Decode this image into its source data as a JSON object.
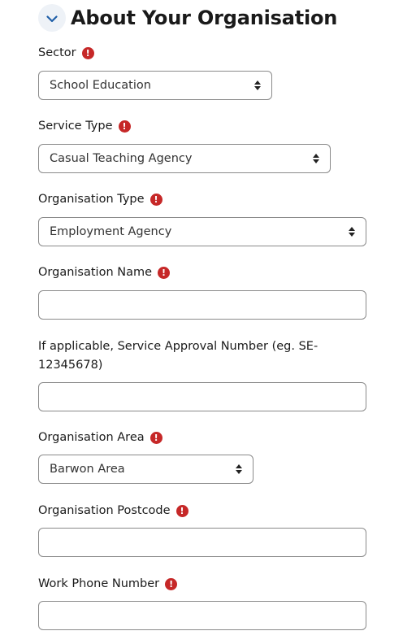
{
  "section": {
    "title": "About Your Organisation"
  },
  "fields": {
    "sector": {
      "label": "Sector",
      "value": "School Education"
    },
    "service_type": {
      "label": "Service Type",
      "value": "Casual Teaching Agency"
    },
    "organisation_type": {
      "label": "Organisation Type",
      "value": "Employment Agency"
    },
    "organisation_name": {
      "label": "Organisation Name",
      "value": ""
    },
    "service_approval": {
      "label": "If applicable, Service Approval Number (eg. SE-12345678)",
      "value": ""
    },
    "organisation_area": {
      "label": "Organisation Area",
      "value": "Barwon Area"
    },
    "organisation_postcode": {
      "label": "Organisation Postcode",
      "value": ""
    },
    "work_phone": {
      "label": "Work Phone Number",
      "value": ""
    }
  },
  "required_mark": "!",
  "colors": {
    "required": "#c62828",
    "accent": "#1f5fa8",
    "border": "#8a8a8a"
  },
  "icons": {
    "collapse": "chevron-down-icon",
    "required": "exclamation-icon",
    "select": "sort-arrows-icon"
  }
}
